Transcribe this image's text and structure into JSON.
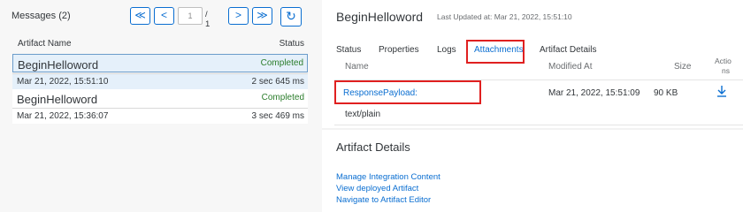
{
  "left": {
    "messages_label": "Messages (2)",
    "pager": {
      "first": "≪",
      "prev": "<",
      "current": "1",
      "total": "/ 1",
      "next": ">",
      "last": "≫"
    },
    "refresh_icon": "refresh-icon",
    "columns": {
      "name": "Artifact Name",
      "status": "Status"
    },
    "rows": [
      {
        "name": "BeginHelloword",
        "status": "Completed",
        "date": "Mar 21, 2022, 15:51:10",
        "duration": "2 sec 645 ms"
      },
      {
        "name": "BeginHelloword",
        "status": "Completed",
        "date": "Mar 21, 2022, 15:36:07",
        "duration": "3 sec 469 ms"
      }
    ]
  },
  "right": {
    "title": "BeginHelloword",
    "updated": "Last Updated at: Mar 21, 2022, 15:51:10",
    "tabs": [
      "Status",
      "Properties",
      "Logs",
      "Attachments",
      "Artifact Details"
    ],
    "active_tab": "Attachments",
    "attachments": {
      "headers": {
        "name": "Name",
        "modified": "Modified At",
        "size": "Size",
        "actions_1": "Actio",
        "actions_2": "ns"
      },
      "row": {
        "name": "ResponsePayload:",
        "modified": "Mar 21, 2022, 15:51:09",
        "size": "90 KB",
        "mime": "text/plain",
        "action_icon": "download-icon"
      }
    },
    "artifact_details": {
      "title": "Artifact Details",
      "links": [
        "Manage Integration Content",
        "View deployed Artifact",
        "Navigate to Artifact Editor"
      ]
    }
  },
  "colors": {
    "accent": "#0a6ed1",
    "success": "#2b7d2b",
    "highlight": "#e02020"
  }
}
